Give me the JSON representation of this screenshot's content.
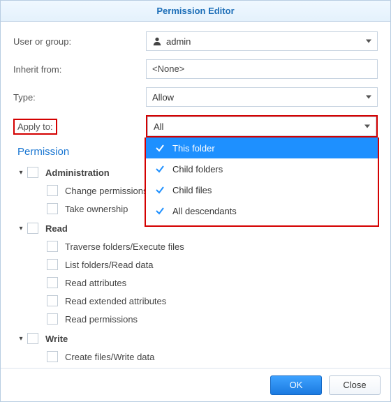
{
  "dialog": {
    "title": "Permission Editor"
  },
  "fields": {
    "userOrGroup": {
      "label": "User or group:",
      "value": "admin"
    },
    "inheritFrom": {
      "label": "Inherit from:",
      "value": "<None>"
    },
    "type": {
      "label": "Type:",
      "value": "Allow"
    },
    "applyTo": {
      "label": "Apply to:",
      "value": "All"
    }
  },
  "applyToOptions": [
    {
      "label": "This folder",
      "checked": true,
      "selected": true
    },
    {
      "label": "Child folders",
      "checked": true,
      "selected": false
    },
    {
      "label": "Child files",
      "checked": true,
      "selected": false
    },
    {
      "label": "All descendants",
      "checked": true,
      "selected": false
    }
  ],
  "permissions": {
    "heading": "Permission",
    "administration": {
      "label": "Administration",
      "items": [
        "Change permissions",
        "Take ownership"
      ]
    },
    "read": {
      "label": "Read",
      "items": [
        "Traverse folders/Execute files",
        "List folders/Read data",
        "Read attributes",
        "Read extended attributes",
        "Read permissions"
      ]
    },
    "write": {
      "label": "Write",
      "items": [
        "Create files/Write data"
      ]
    }
  },
  "buttons": {
    "ok": "OK",
    "close": "Close"
  }
}
